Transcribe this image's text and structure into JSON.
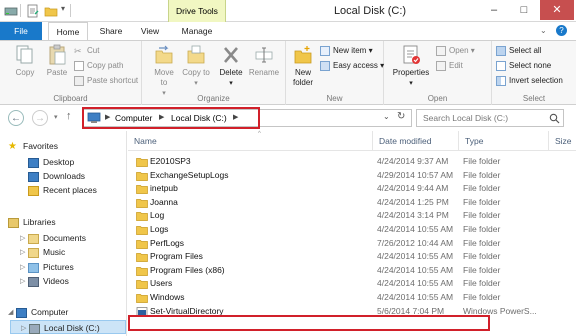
{
  "window": {
    "title": "Local Disk (C:)",
    "context_tab": "Drive Tools",
    "controls": {
      "minimize": "–",
      "maximize": "□",
      "close": "✕"
    }
  },
  "tabs": [
    "File",
    "Home",
    "Share",
    "View",
    "Manage"
  ],
  "ribbon": {
    "clipboard": {
      "label": "Clipboard",
      "copy": "Copy",
      "paste": "Paste",
      "cut": "Cut",
      "copy_path": "Copy path",
      "paste_shortcut": "Paste shortcut"
    },
    "organize": {
      "label": "Organize",
      "move_to": "Move to",
      "copy_to": "Copy to",
      "delete": "Delete",
      "rename": "Rename"
    },
    "new": {
      "label": "New",
      "new_folder": "New folder",
      "new_item": "New item",
      "easy_access": "Easy access"
    },
    "open": {
      "label": "Open",
      "properties": "Properties",
      "open": "Open",
      "edit": "Edit"
    },
    "select": {
      "label": "Select",
      "select_all": "Select all",
      "select_none": "Select none",
      "invert": "Invert selection"
    }
  },
  "address": {
    "crumbs": [
      "Computer",
      "Local Disk (C:)"
    ],
    "search_placeholder": "Search Local Disk (C:)"
  },
  "navpane": {
    "favorites": "Favorites",
    "desktop": "Desktop",
    "downloads": "Downloads",
    "recent": "Recent places",
    "libraries": "Libraries",
    "documents": "Documents",
    "music": "Music",
    "pictures": "Pictures",
    "videos": "Videos",
    "computer": "Computer",
    "local_disk": "Local Disk (C:)"
  },
  "columns": {
    "name": "Name",
    "date": "Date modified",
    "type": "Type",
    "size": "Size"
  },
  "files": [
    {
      "name": "E2010SP3",
      "date": "4/24/2014 9:37 AM",
      "type": "File folder",
      "icon": "folder-icon"
    },
    {
      "name": "ExchangeSetupLogs",
      "date": "4/29/2014 10:57 AM",
      "type": "File folder",
      "icon": "folder-icon"
    },
    {
      "name": "inetpub",
      "date": "4/24/2014 9:44 AM",
      "type": "File folder",
      "icon": "folder-icon"
    },
    {
      "name": "Joanna",
      "date": "4/24/2014 1:25 PM",
      "type": "File folder",
      "icon": "folder-icon"
    },
    {
      "name": "Log",
      "date": "4/24/2014 3:14 PM",
      "type": "File folder",
      "icon": "folder-icon"
    },
    {
      "name": "Logs",
      "date": "4/24/2014 10:55 AM",
      "type": "File folder",
      "icon": "folder-icon"
    },
    {
      "name": "PerfLogs",
      "date": "7/26/2012 10:44 AM",
      "type": "File folder",
      "icon": "folder-icon"
    },
    {
      "name": "Program Files",
      "date": "4/24/2014 10:55 AM",
      "type": "File folder",
      "icon": "folder-icon"
    },
    {
      "name": "Program Files (x86)",
      "date": "4/24/2014 10:55 AM",
      "type": "File folder",
      "icon": "folder-icon"
    },
    {
      "name": "Users",
      "date": "4/24/2014 10:55 AM",
      "type": "File folder",
      "icon": "folder-icon"
    },
    {
      "name": "Windows",
      "date": "4/24/2014 10:55 AM",
      "type": "File folder",
      "icon": "folder-icon"
    },
    {
      "name": "Set-VirtualDirectory",
      "date": "5/6/2014 7:04 PM",
      "type": "Windows PowerS...",
      "icon": "powershell-script-icon"
    }
  ]
}
